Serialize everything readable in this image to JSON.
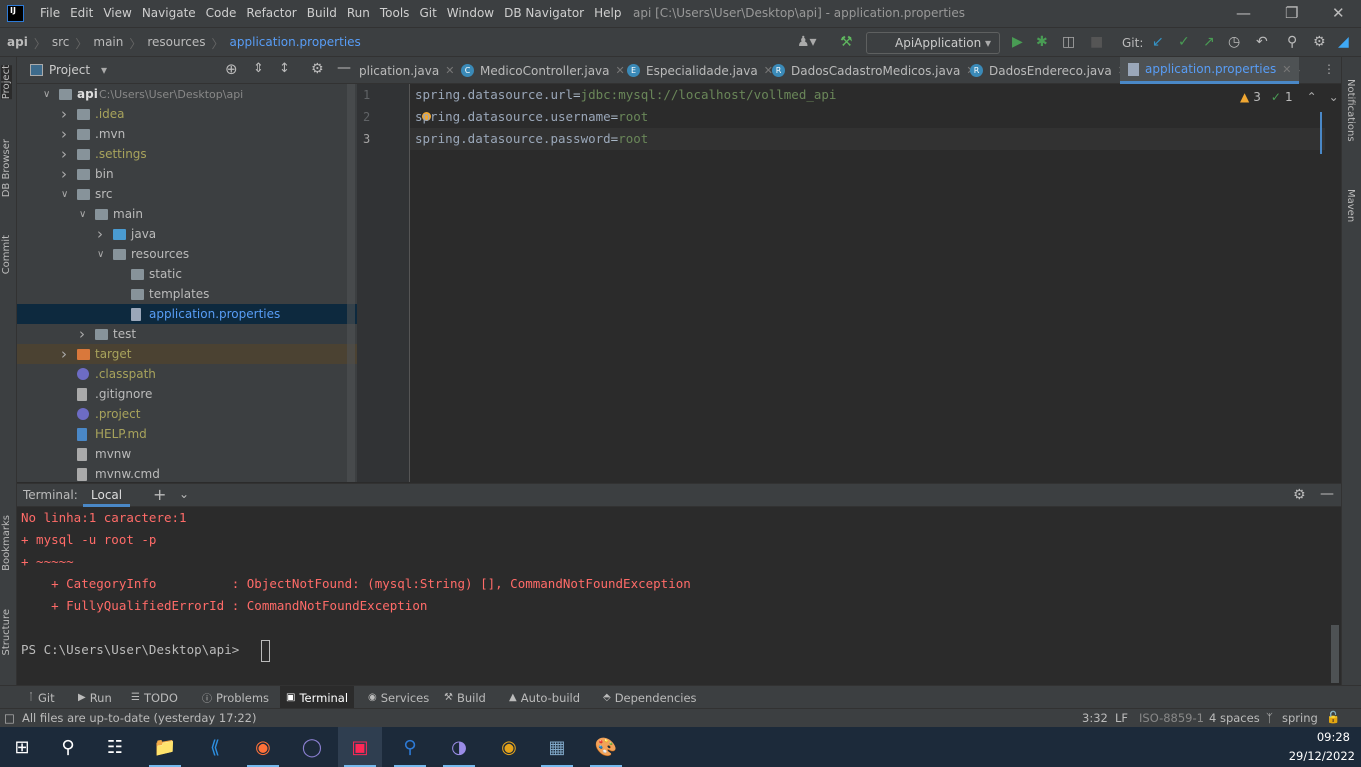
{
  "app": {
    "logo": "IJ",
    "title": "api [C:\\Users\\User\\Desktop\\api] - application.properties"
  },
  "menu": [
    "File",
    "Edit",
    "View",
    "Navigate",
    "Code",
    "Refactor",
    "Build",
    "Run",
    "Tools",
    "Git",
    "Window",
    "DB Navigator",
    "Help"
  ],
  "breadcrumb": [
    "api",
    "src",
    "main",
    "resources",
    "application.properties"
  ],
  "toolbar": {
    "run_config": "ApiApplication",
    "git_label": "Git:"
  },
  "left_strip": [
    "Project",
    "DB Browser",
    "Commit",
    "Bookmarks",
    "Structure"
  ],
  "right_strip": [
    "Notifications",
    "Maven"
  ],
  "project_panel": {
    "title": "Project"
  },
  "tree": [
    {
      "label": "api",
      "path": "C:\\Users\\User\\Desktop\\api",
      "level": 0,
      "expanded": true,
      "icon": "folder"
    },
    {
      "label": ".idea",
      "level": 1,
      "collapsed": true,
      "icon": "folder",
      "ignored": true
    },
    {
      "label": ".mvn",
      "level": 1,
      "collapsed": true,
      "icon": "folder"
    },
    {
      "label": ".settings",
      "level": 1,
      "collapsed": true,
      "icon": "folder",
      "ignored": true
    },
    {
      "label": "bin",
      "level": 1,
      "collapsed": true,
      "icon": "folder"
    },
    {
      "label": "src",
      "level": 1,
      "expanded": true,
      "icon": "folder"
    },
    {
      "label": "main",
      "level": 2,
      "expanded": true,
      "icon": "folder"
    },
    {
      "label": "java",
      "level": 3,
      "collapsed": true,
      "icon": "source-folder"
    },
    {
      "label": "resources",
      "level": 3,
      "expanded": true,
      "icon": "resources-folder"
    },
    {
      "label": "static",
      "level": 4,
      "icon": "folder"
    },
    {
      "label": "templates",
      "level": 4,
      "icon": "folder"
    },
    {
      "label": "application.properties",
      "level": 4,
      "icon": "properties-file",
      "selected": true
    },
    {
      "label": "test",
      "level": 2,
      "collapsed": true,
      "icon": "folder"
    },
    {
      "label": "target",
      "level": 1,
      "collapsed": true,
      "icon": "excluded-folder",
      "ignored": true,
      "highlighted": true
    },
    {
      "label": ".classpath",
      "level": 1,
      "icon": "eclipse-file",
      "ignored": true
    },
    {
      "label": ".gitignore",
      "level": 1,
      "icon": "gitignore-file"
    },
    {
      "label": ".project",
      "level": 1,
      "icon": "eclipse-file",
      "ignored": true
    },
    {
      "label": "HELP.md",
      "level": 1,
      "icon": "markdown-file",
      "ignored": true
    },
    {
      "label": "mvnw",
      "level": 1,
      "icon": "file"
    },
    {
      "label": "mvnw.cmd",
      "level": 1,
      "icon": "file"
    }
  ],
  "tabs": [
    {
      "label": "plication.java",
      "icon": ""
    },
    {
      "label": "MedicoController.java",
      "icon": "C"
    },
    {
      "label": "Especialidade.java",
      "icon": "E"
    },
    {
      "label": "DadosCadastroMedicos.java",
      "icon": "R"
    },
    {
      "label": "DadosEndereco.java",
      "icon": "R"
    },
    {
      "label": "application.properties",
      "icon": "properties",
      "active": true
    }
  ],
  "editor": {
    "inspections": {
      "warnings": "3",
      "weak_warnings": "1"
    },
    "lines": [
      {
        "num": "1",
        "key": "spring.datasource.url",
        "value": "jdbc:mysql://localhost/vollmed_api"
      },
      {
        "num": "2",
        "key": "spring.datasource.username",
        "value": "root"
      },
      {
        "num": "3",
        "key": "spring.datasource.password",
        "value": "root"
      }
    ],
    "eq": "="
  },
  "terminal": {
    "label": "Terminal:",
    "tab": "Local",
    "lines": [
      "No linha:1 caractere:1",
      "+ mysql -u root -p",
      "+ ~~~~~",
      "    + CategoryInfo          : ObjectNotFound: (mysql:String) [], CommandNotFoundException",
      "    + FullyQualifiedErrorId : CommandNotFoundException",
      "",
      "PS C:\\Users\\User\\Desktop\\api> "
    ]
  },
  "tool_windows": [
    "Git",
    "Run",
    "TODO",
    "Problems",
    "Terminal",
    "Services",
    "Build",
    "Auto-build",
    "Dependencies"
  ],
  "status": {
    "message": "All files are up-to-date (yesterday 17:22)",
    "position": "3:32",
    "line_sep": "LF",
    "encoding": "ISO-8859-1",
    "indent": "4 spaces",
    "branch": "spring"
  },
  "clock": {
    "time": "09:28",
    "date": "29/12/2022"
  },
  "colors": {
    "accent": "#4a88c7",
    "selected_row": "#0d293e",
    "error_text": "#ff6b68",
    "ignored": "#a8a35c"
  }
}
